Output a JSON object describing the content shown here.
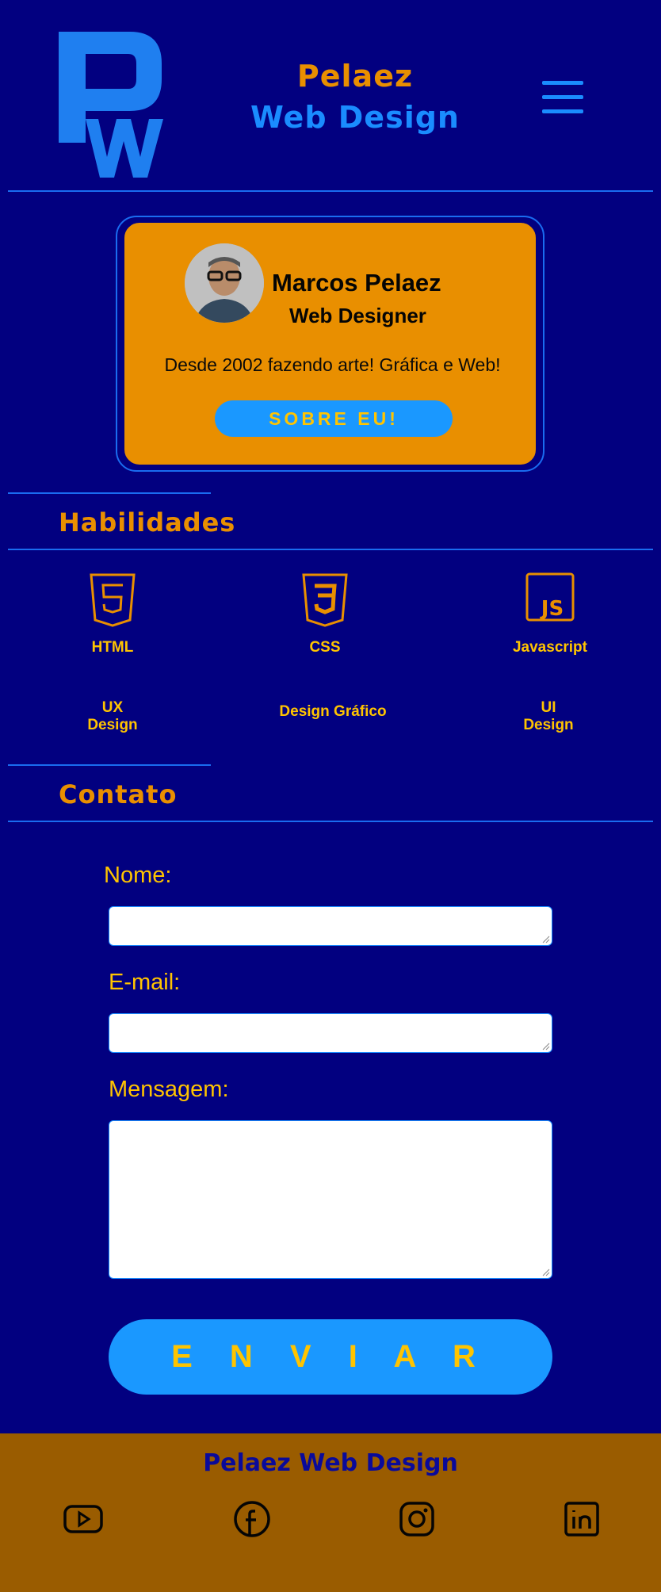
{
  "header": {
    "brand_line1": "Pelaez",
    "brand_line2": "Web Design"
  },
  "profile": {
    "name": "Marcos Pelaez",
    "role": "Web Designer",
    "description": "Desde 2002 fazendo arte! Gráfica e Web!",
    "about_button": "SOBRE EU!"
  },
  "skills": {
    "title": "Habilidades",
    "items": [
      {
        "label": "HTML",
        "icon": "html5-icon"
      },
      {
        "label": "CSS",
        "icon": "css3-icon"
      },
      {
        "label": "Javascript",
        "icon": "js-icon"
      },
      {
        "label": "UX\nDesign",
        "icon": ""
      },
      {
        "label": "Design Gráfico",
        "icon": ""
      },
      {
        "label": "UI\nDesign",
        "icon": ""
      }
    ]
  },
  "contact": {
    "title": "Contato",
    "name_label": "Nome:",
    "email_label": "E-mail:",
    "message_label": "Mensagem:",
    "name_value": "",
    "email_value": "",
    "message_value": "",
    "send_button": "E N V I A R"
  },
  "footer": {
    "brand": "Pelaez Web Design",
    "social": [
      "youtube-icon",
      "facebook-icon",
      "instagram-icon",
      "linkedin-icon"
    ]
  },
  "colors": {
    "background": "#020080",
    "accent_orange": "#e98f00",
    "accent_blue": "#1a8cff",
    "accent_yellow": "#ffc400",
    "footer": "#9a5c00"
  }
}
